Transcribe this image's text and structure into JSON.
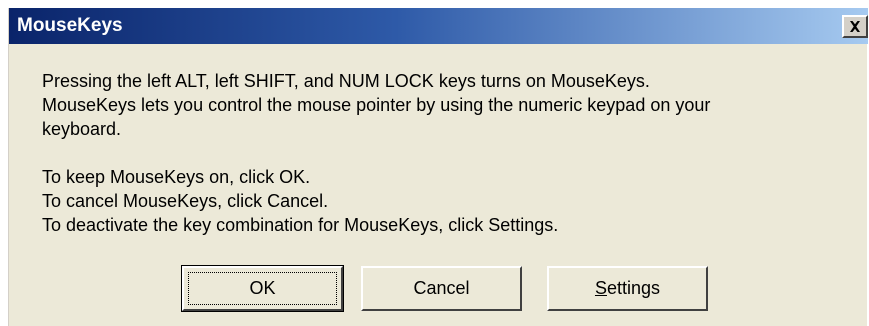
{
  "window": {
    "title": "MouseKeys",
    "close_icon": "close-icon"
  },
  "message": {
    "lines": [
      "Pressing the left ALT, left SHIFT, and NUM LOCK keys turns on MouseKeys.",
      "MouseKeys lets you control the mouse pointer by using the numeric keypad on your",
      "keyboard.",
      "To keep MouseKeys on, click OK.",
      "To cancel MouseKeys, click Cancel.",
      "To deactivate the key combination for MouseKeys, click Settings."
    ]
  },
  "buttons": {
    "ok_label": "OK",
    "cancel_label": "Cancel",
    "settings_mnemonic": "S",
    "settings_rest": "ettings"
  },
  "colors": {
    "title_bar_start": "#0a246a",
    "title_bar_end": "#a6caf0",
    "dialog_bg": "#ece9d8"
  }
}
